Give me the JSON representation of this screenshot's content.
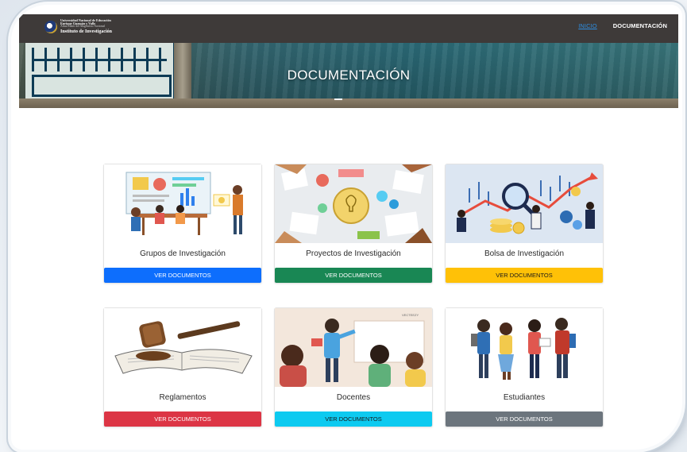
{
  "header": {
    "brand": {
      "line1": "Universidad Nacional de Educación",
      "line2": "Enrique Guzmán y Valle",
      "line3": "Alma Máter del Magisterio Nacional",
      "line4": "Instituto de Investigación"
    },
    "nav": [
      {
        "label": "INICIO",
        "active": true
      },
      {
        "label": "DOCUMENTACIÓN",
        "active": false
      }
    ]
  },
  "banner": {
    "title": "DOCUMENTACIÓN"
  },
  "cards": [
    {
      "title": "Grupos de Investigación",
      "button": "VER DOCUMENTOS",
      "color": "#0d6efd"
    },
    {
      "title": "Proyectos de Investigación",
      "button": "VER DOCUMENTOS",
      "color": "#198754"
    },
    {
      "title": "Bolsa de Investigación",
      "button": "VER DOCUMENTOS",
      "color": "#ffc107"
    },
    {
      "title": "Reglamentos",
      "button": "VER DOCUMENTOS",
      "color": "#dc3545"
    },
    {
      "title": "Docentes",
      "button": "VER DOCUMENTOS",
      "color": "#0dcaf0"
    },
    {
      "title": "Estudiantes",
      "button": "VER DOCUMENTOS",
      "color": "#6c757d"
    }
  ],
  "docentes_watermark": "VECTEEZY"
}
